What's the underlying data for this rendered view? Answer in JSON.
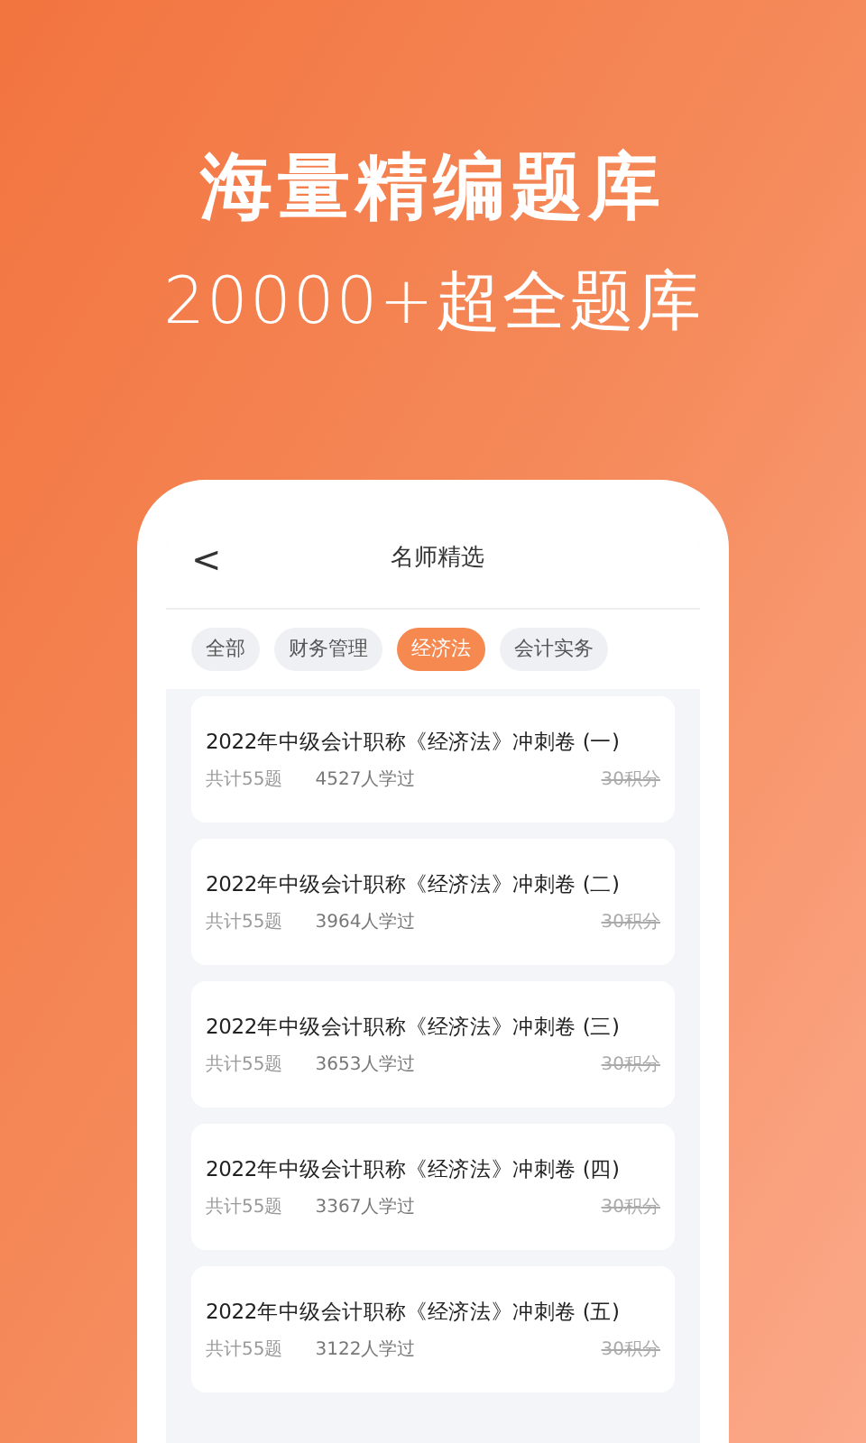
{
  "headline": "海量精编题库",
  "subheadline": "20000+超全题库",
  "screen": {
    "back": "<",
    "title": "名师精选",
    "tabs": [
      {
        "label": "全部",
        "selected": false
      },
      {
        "label": "财务管理",
        "selected": false
      },
      {
        "label": "经济法",
        "selected": true
      },
      {
        "label": "会计实务",
        "selected": false
      }
    ],
    "papers": [
      {
        "title": "2022年中级会计职称《经济法》冲刺卷 (一)",
        "count": "共计55题",
        "learners": "4527人学过",
        "price": "30积分"
      },
      {
        "title": "2022年中级会计职称《经济法》冲刺卷 (二)",
        "count": "共计55题",
        "learners": "3964人学过",
        "price": "30积分"
      },
      {
        "title": "2022年中级会计职称《经济法》冲刺卷 (三)",
        "count": "共计55题",
        "learners": "3653人学过",
        "price": "30积分"
      },
      {
        "title": "2022年中级会计职称《经济法》冲刺卷 (四)",
        "count": "共计55题",
        "learners": "3367人学过",
        "price": "30积分"
      },
      {
        "title": "2022年中级会计职称《经济法》冲刺卷 (五)",
        "count": "共计55题",
        "learners": "3122人学过",
        "price": "30积分"
      }
    ]
  }
}
